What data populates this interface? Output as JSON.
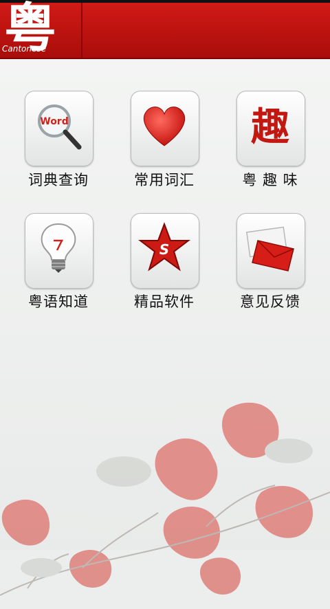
{
  "header": {
    "logo_glyph": "粤",
    "logo_sub": "Cantonese"
  },
  "grid": [
    {
      "label": "词典查询",
      "icon": "word-search-icon",
      "icon_text": "Word"
    },
    {
      "label": "常用词汇",
      "icon": "heart-icon"
    },
    {
      "label": "粤 趣 味",
      "icon": "qu-character-icon",
      "icon_text": "趣"
    },
    {
      "label": "粤语知道",
      "icon": "lightbulb-icon"
    },
    {
      "label": "精品软件",
      "icon": "star-icon",
      "icon_text": "S"
    },
    {
      "label": "意见反馈",
      "icon": "envelope-icon"
    }
  ],
  "colors": {
    "header_red": "#c0120f",
    "accent_red": "#d4211b"
  }
}
